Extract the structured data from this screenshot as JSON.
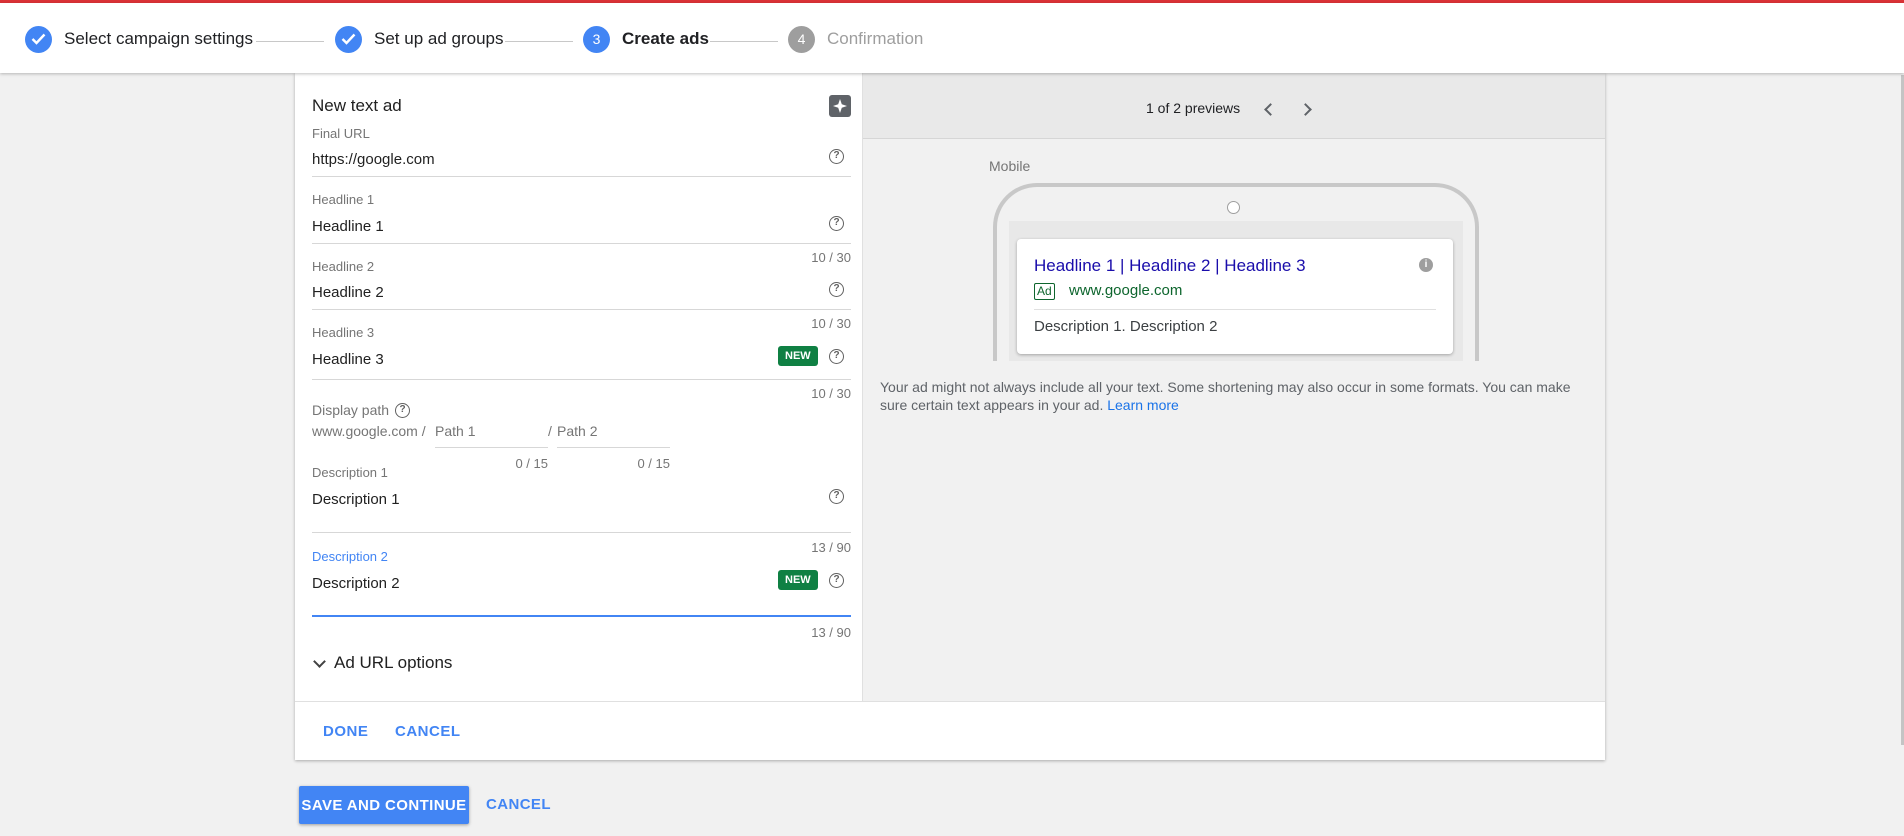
{
  "stepper": {
    "steps": [
      {
        "number": "1",
        "label": "Select campaign settings",
        "status": "done"
      },
      {
        "number": "2",
        "label": "Set up ad groups",
        "status": "done"
      },
      {
        "number": "3",
        "label": "Create ads",
        "status": "active"
      },
      {
        "number": "4",
        "label": "Confirmation",
        "status": "todo"
      }
    ]
  },
  "editor": {
    "title": "New text ad",
    "final_url": {
      "label": "Final URL",
      "value": "https://google.com"
    },
    "headline1": {
      "label": "Headline 1",
      "value": "Headline 1",
      "counter": "10 / 30"
    },
    "headline2": {
      "label": "Headline 2",
      "value": "Headline 2",
      "counter": "10 / 30"
    },
    "headline3": {
      "label": "Headline 3",
      "value": "Headline 3",
      "counter": "10 / 30",
      "badge": "NEW"
    },
    "display_path": {
      "label": "Display path",
      "base": "www.google.com",
      "sep1": "/",
      "path1_placeholder": "Path 1",
      "sep2": "/",
      "path2_placeholder": "Path 2",
      "path1_counter": "0 / 15",
      "path2_counter": "0 / 15"
    },
    "description1": {
      "label": "Description 1",
      "value": "Description 1",
      "counter": "13 / 90"
    },
    "description2": {
      "label": "Description 2",
      "value": "Description 2",
      "counter": "13 / 90",
      "badge": "NEW"
    },
    "ad_url_options": "Ad URL options",
    "help_glyph": "?",
    "done_label": "DONE",
    "cancel_label": "CANCEL"
  },
  "preview": {
    "count_text": "1 of 2 previews",
    "device_label": "Mobile",
    "ad": {
      "headline": "Headline 1 | Headline 2 | Headline 3",
      "badge": "Ad",
      "url": "www.google.com",
      "description": "Description 1. Description 2",
      "info_glyph": "i"
    },
    "note": "Your ad might not always include all your text. Some shortening may also occur in some formats. You can make sure certain text appears in your ad.",
    "learn_more": "Learn more"
  },
  "footer": {
    "save_label": "SAVE AND CONTINUE",
    "cancel_label": "CANCEL"
  },
  "colors": {
    "accent": "#4285f4",
    "top_bar": "#db3236",
    "badge_green": "#0f8043",
    "ad_headline": "#1a0dab",
    "ad_url": "#0d652d"
  }
}
